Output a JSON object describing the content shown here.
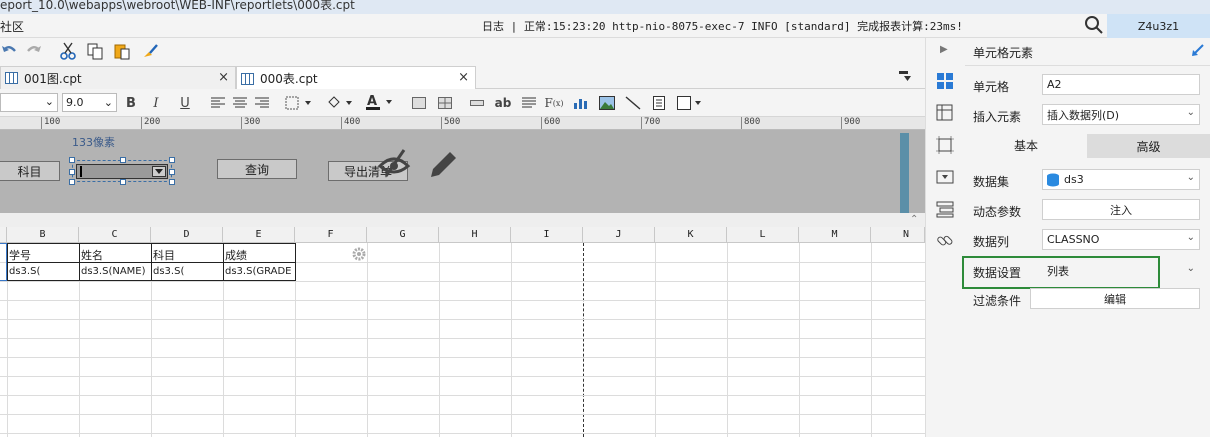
{
  "window": {
    "path_title": "eport_10.0\\webapps\\webroot\\WEB-INF\\reportlets\\000表.cpt",
    "menu_left": "社区",
    "log_text": "日志 | 正常:15:23:20 http-nio-8075-exec-7 INFO [standard] 完成报表计算:23ms!",
    "user": "Z4u3z1"
  },
  "tabs": [
    {
      "label": "001图.cpt",
      "close": "×"
    },
    {
      "label": "000表.cpt",
      "close": "×"
    }
  ],
  "format": {
    "font_size": "9.0"
  },
  "ruler": {
    "ticks": [
      "100",
      "200",
      "300",
      "400",
      "500",
      "600",
      "700",
      "800",
      "900"
    ]
  },
  "params": {
    "label_subject": "科目",
    "size_hint": "133像素",
    "query_button": "查询",
    "export_button": "导出清单"
  },
  "sheet": {
    "columns": [
      "B",
      "C",
      "D",
      "E",
      "F",
      "G",
      "H",
      "I",
      "J",
      "K",
      "L",
      "M",
      "N"
    ],
    "headers": [
      "学号",
      "姓名",
      "科目",
      "成绩"
    ],
    "values": [
      "ds3.S(",
      "ds3.S(NAME)",
      "ds3.S(",
      "ds3.S(GRADE"
    ]
  },
  "panel": {
    "title": "单元格元素",
    "cell_label": "单元格",
    "cell_value": "A2",
    "insert_label": "插入元素",
    "insert_value": "插入数据列(D)",
    "tab_basic": "基本",
    "tab_advanced": "高级",
    "dataset_label": "数据集",
    "dataset_value": "ds3",
    "dynamic_label": "动态参数",
    "dynamic_button": "注入",
    "column_label": "数据列",
    "column_value": "CLASSNO",
    "setting_label": "数据设置",
    "setting_value": "列表",
    "filter_label": "过滤条件",
    "filter_button": "编辑",
    "highlight_color": "#2e8b3a"
  }
}
